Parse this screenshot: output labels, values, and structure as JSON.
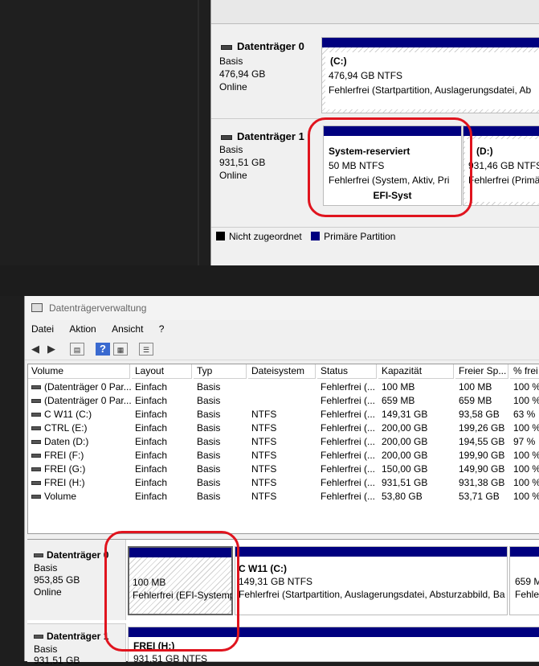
{
  "top_panel": {
    "disk0": {
      "title": "Datenträger 0",
      "type": "Basis",
      "size": "476,94 GB",
      "status": "Online",
      "partition": {
        "name": "(C:)",
        "size": "476,94 GB NTFS",
        "state": "Fehlerfrei (Startpartition, Auslagerungsdatei, Ab"
      }
    },
    "disk1": {
      "title": "Datenträger 1",
      "type": "Basis",
      "size": "931,51 GB",
      "status": "Online",
      "part1": {
        "name": "System-reserviert",
        "size": "50 MB NTFS",
        "state": "Fehlerfrei (System, Aktiv, Pri",
        "label": "EFI-Syst"
      },
      "part2": {
        "name": "(D:)",
        "size": "931,46 GB NTFS",
        "state": "Fehlerfrei (Primä"
      }
    },
    "legend": {
      "unallocated": "Nicht zugeordnet",
      "primary": "Primäre Partition"
    }
  },
  "window": {
    "title": "Datenträgerverwaltung",
    "menu": [
      "Datei",
      "Aktion",
      "Ansicht",
      "?"
    ],
    "columns": [
      "Volume",
      "Layout",
      "Typ",
      "Dateisystem",
      "Status",
      "Kapazität",
      "Freier Sp...",
      "% frei"
    ],
    "rows": [
      [
        "(Datenträger 0 Par...",
        "Einfach",
        "Basis",
        "",
        "Fehlerfrei (...",
        "100 MB",
        "100 MB",
        "100 %"
      ],
      [
        "(Datenträger 0 Par...",
        "Einfach",
        "Basis",
        "",
        "Fehlerfrei (...",
        "659 MB",
        "659 MB",
        "100 %"
      ],
      [
        "C W11 (C:)",
        "Einfach",
        "Basis",
        "NTFS",
        "Fehlerfrei (...",
        "149,31 GB",
        "93,58 GB",
        "63 %"
      ],
      [
        "CTRL (E:)",
        "Einfach",
        "Basis",
        "NTFS",
        "Fehlerfrei (...",
        "200,00 GB",
        "199,26 GB",
        "100 %"
      ],
      [
        "Daten (D:)",
        "Einfach",
        "Basis",
        "NTFS",
        "Fehlerfrei (...",
        "200,00 GB",
        "194,55 GB",
        "97 %"
      ],
      [
        "FREI (F:)",
        "Einfach",
        "Basis",
        "NTFS",
        "Fehlerfrei (...",
        "200,00 GB",
        "199,90 GB",
        "100 %"
      ],
      [
        "FREI (G:)",
        "Einfach",
        "Basis",
        "NTFS",
        "Fehlerfrei (...",
        "150,00 GB",
        "149,90 GB",
        "100 %"
      ],
      [
        "FREI (H:)",
        "Einfach",
        "Basis",
        "NTFS",
        "Fehlerfrei (...",
        "931,51 GB",
        "931,38 GB",
        "100 %"
      ],
      [
        "Volume",
        "Einfach",
        "Basis",
        "NTFS",
        "Fehlerfrei (...",
        "53,80 GB",
        "53,71 GB",
        "100 %"
      ]
    ],
    "graph": {
      "disk0": {
        "title": "Datenträger 0",
        "type": "Basis",
        "size": "953,85 GB",
        "status": "Online",
        "efi": {
          "size": "100 MB",
          "state": "Fehlerfrei (EFI-Systemp"
        },
        "c": {
          "name": "C W11  (C:)",
          "size": "149,31 GB NTFS",
          "state": "Fehlerfrei (Startpartition, Auslagerungsdatei, Absturzabbild, Ba"
        },
        "rec": {
          "size": "659 M",
          "state": "Fehler"
        }
      },
      "disk1": {
        "title": "Datenträger 1",
        "type": "Basis",
        "size": "931,51 GB",
        "h": {
          "name": "FREI  (H:)",
          "size": "931,51 GB NTFS"
        }
      }
    }
  },
  "colors": {
    "primary_bar": "#00007f",
    "highlight": "#e0141e"
  }
}
